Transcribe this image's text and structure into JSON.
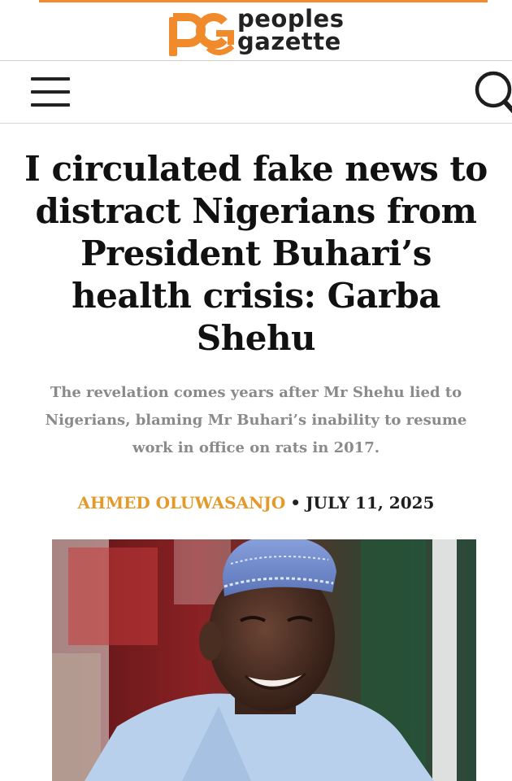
{
  "site": {
    "brand_line1": "peoples",
    "brand_line2": "gazette",
    "brand_color": "#f08a2a",
    "logo_mark_letters": "pg"
  },
  "nav": {
    "menu_icon": "hamburger-menu-icon",
    "search_icon": "search-icon"
  },
  "article": {
    "headline": "I circulated fake news to distract Nigerians from President Buhari’s health crisis: Garba Shehu",
    "subtitle": "The revelation comes years after Mr Shehu lied to Nigerians, blaming Mr Buhari’s inability to resume work in office on rats in 2017.",
    "author": "AHMED OLUWASANJO",
    "separator": "•",
    "date": "JULY 11, 2025",
    "author_color": "#e39a2b"
  }
}
